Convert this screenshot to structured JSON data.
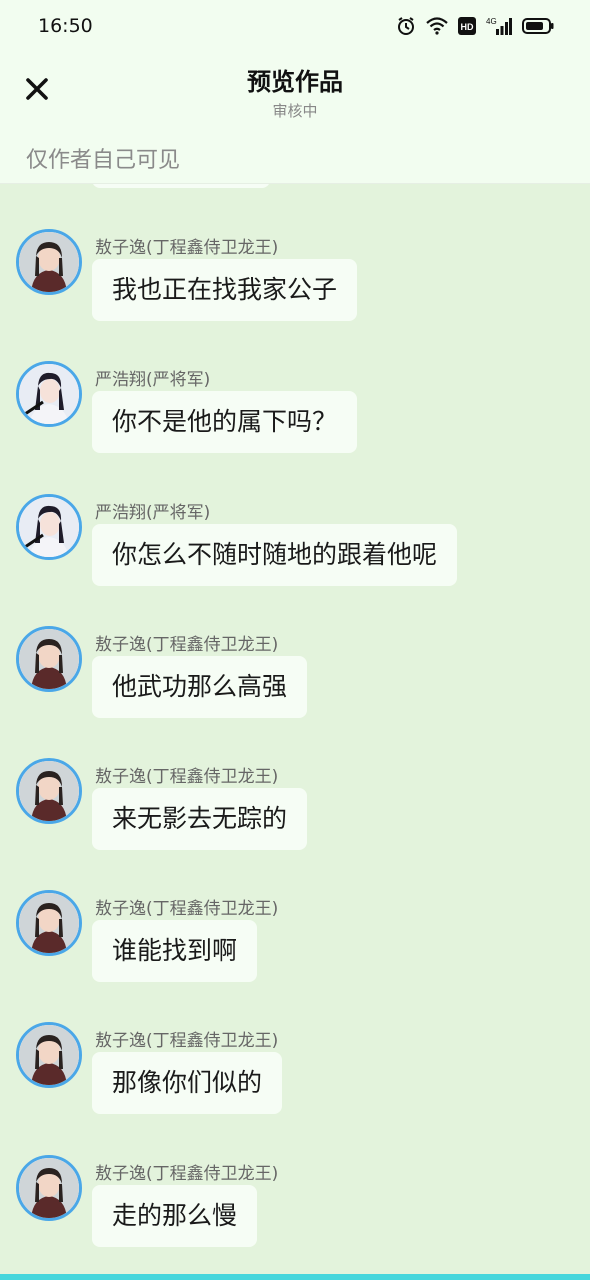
{
  "status_bar": {
    "time": "16:50",
    "icons": [
      "alarm-icon",
      "wifi-icon",
      "hd-icon",
      "signal-4g-icon",
      "battery-icon"
    ],
    "hd_label": "HD",
    "network_label": "4G"
  },
  "header": {
    "title": "预览作品",
    "subtitle": "审核中",
    "visibility_note": "仅作者自己可见"
  },
  "messages": [
    {
      "sender": "敖子逸(丁程鑫侍卫龙王)",
      "text": "我也正在找我家公子",
      "avatar": "character-a"
    },
    {
      "sender": "严浩翔(严将军)",
      "text": "你不是他的属下吗？",
      "avatar": "character-b"
    },
    {
      "sender": "严浩翔(严将军)",
      "text": "你怎么不随时随地的跟着他呢",
      "avatar": "character-b"
    },
    {
      "sender": "敖子逸(丁程鑫侍卫龙王)",
      "text": "他武功那么高强",
      "avatar": "character-a"
    },
    {
      "sender": "敖子逸(丁程鑫侍卫龙王)",
      "text": "来无影去无踪的",
      "avatar": "character-a"
    },
    {
      "sender": "敖子逸(丁程鑫侍卫龙王)",
      "text": "谁能找到啊",
      "avatar": "character-a"
    },
    {
      "sender": "敖子逸(丁程鑫侍卫龙王)",
      "text": "那像你们似的",
      "avatar": "character-a"
    },
    {
      "sender": "敖子逸(丁程鑫侍卫龙王)",
      "text": "走的那么慢",
      "avatar": "character-a"
    }
  ],
  "colors": {
    "background": "#e3f3dc",
    "header_bg": "#f2fdf0",
    "bubble_bg": "#f6fdf5",
    "avatar_ring": "#4aa7e8",
    "bottom_accent": "#46d6dc"
  }
}
